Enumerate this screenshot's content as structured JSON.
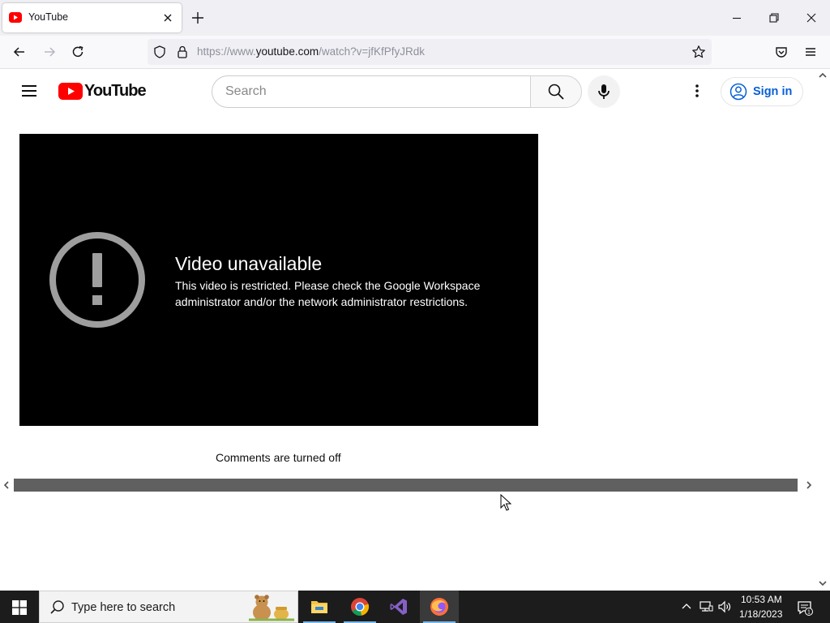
{
  "browser": {
    "tab_title": "YouTube",
    "url_prefix": "https://www.",
    "url_domain": "youtube.com",
    "url_path": "/watch?v=jfKfPfyJRdk"
  },
  "youtube": {
    "logo_text": "YouTube",
    "search_placeholder": "Search",
    "sign_in_label": "Sign in",
    "error_title": "Video unavailable",
    "error_message": "This video is restricted. Please check the Google Workspace administrator and/or the network administrator restrictions.",
    "comments_status": "Comments are turned off"
  },
  "taskbar": {
    "search_placeholder": "Type here to search",
    "apps": [
      "file-explorer",
      "chrome",
      "visual-studio",
      "firefox"
    ],
    "active_app": "firefox",
    "time": "10:53 AM",
    "date": "1/18/2023",
    "notification_count": "1"
  },
  "colors": {
    "youtube_red": "#ff0000",
    "link_blue": "#065fd4",
    "player_bg": "#000000",
    "taskbar_bg": "#1c1c1c"
  }
}
